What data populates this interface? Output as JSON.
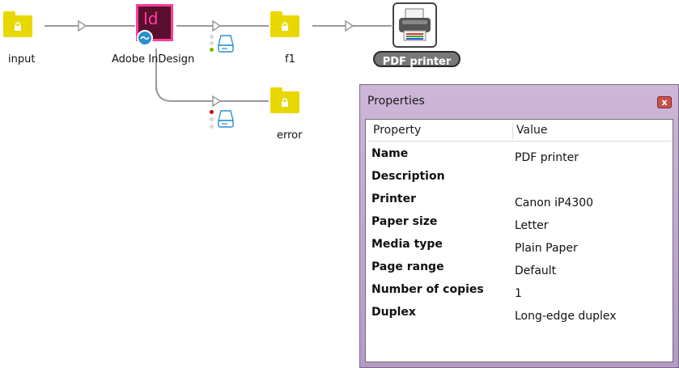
{
  "nodes": {
    "input": {
      "label": "input"
    },
    "indesign": {
      "label": "Adobe InDesign",
      "icon_text": "Id"
    },
    "f1": {
      "label": "f1"
    },
    "pdf_printer": {
      "label": "PDF printer"
    },
    "error": {
      "label": "error"
    }
  },
  "properties": {
    "title": "Properties",
    "close_label": "x",
    "columns": {
      "property": "Property",
      "value": "Value"
    },
    "rows": [
      {
        "name": "Name",
        "value": "PDF printer"
      },
      {
        "name": "Description",
        "value": ""
      },
      {
        "name": "Printer",
        "value": "Canon iP4300"
      },
      {
        "name": "Paper size",
        "value": "Letter"
      },
      {
        "name": "Media type",
        "value": "Plain Paper"
      },
      {
        "name": "Page range",
        "value": "Default"
      },
      {
        "name": "Number of copies",
        "value": "1"
      },
      {
        "name": "Duplex",
        "value": "Long-edge duplex"
      }
    ]
  },
  "colors": {
    "folder": "#e8d800",
    "indesign_bg": "#5a0f2e",
    "indesign_accent": "#ff3e9a",
    "connector": "#9a9a9a",
    "window_titlebar": "#c2a9d4",
    "success_dot": "#7ab800",
    "error_dot": "#cc0000"
  }
}
